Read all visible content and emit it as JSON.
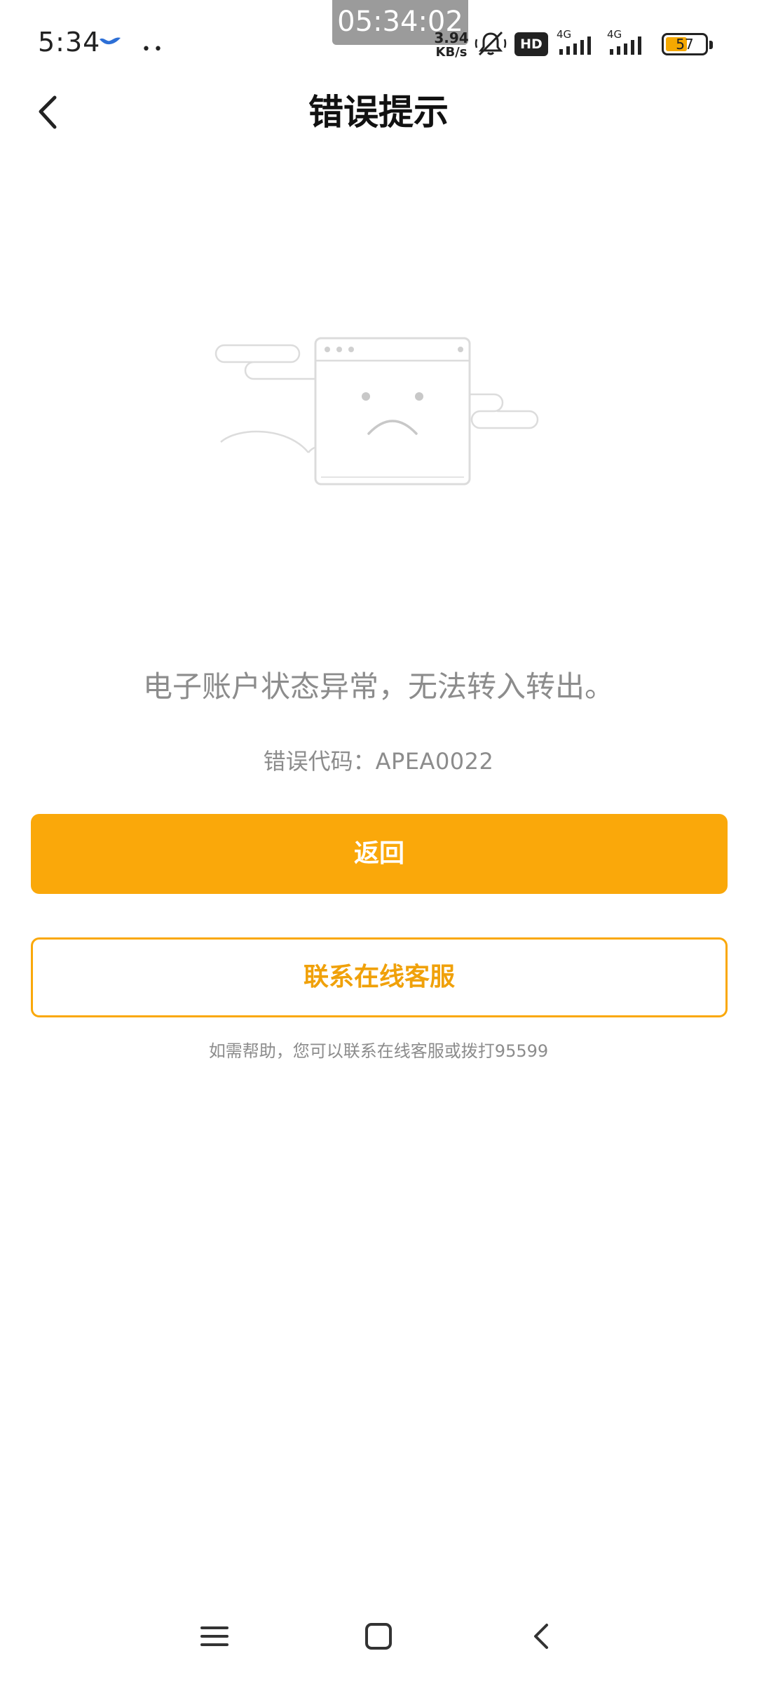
{
  "status_bar": {
    "time": "5:34",
    "overlay_clock": "05:34:02",
    "net_speed_value": "3.94",
    "net_speed_unit": "KB/s",
    "hd_label": "HD",
    "signal1_label": "4G",
    "signal2_label": "4G",
    "battery_level": "57",
    "icons": [
      "bird-icon",
      "more-dots-icon",
      "mute-bell-icon",
      "hd-icon",
      "signal-icon",
      "battery-icon"
    ]
  },
  "nav": {
    "title": "错误提示",
    "back_icon": "chevron-left-icon"
  },
  "error": {
    "message": "电子账户状态异常，无法转入转出。",
    "code_label": "错误代码：",
    "code_value": "APEA0022",
    "illustration": "sad-browser-window-illustration"
  },
  "actions": {
    "primary_label": "返回",
    "secondary_label": "联系在线客服"
  },
  "help": {
    "text": "如需帮助，您可以联系在线客服或拨打95599"
  },
  "colors": {
    "accent": "#faa80a",
    "text_gray": "#8c8c8c",
    "title": "#111111"
  },
  "system_nav": {
    "icons": [
      "menu-icon",
      "home-icon",
      "back-icon"
    ]
  }
}
